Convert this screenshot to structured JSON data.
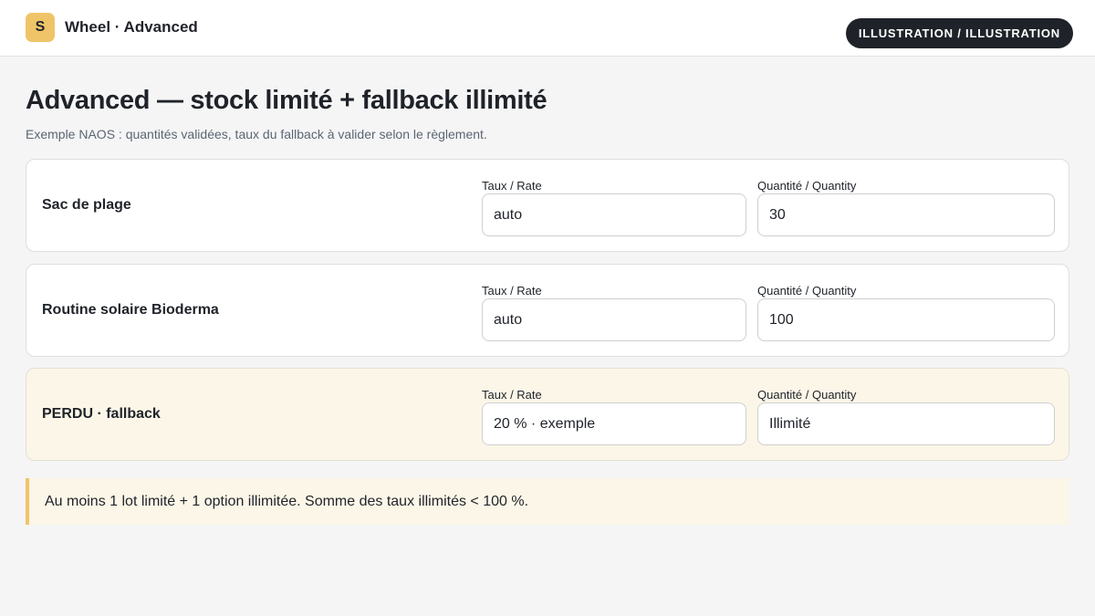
{
  "header": {
    "logo_letter": "S",
    "app_title": "Wheel · Advanced",
    "badge": "ILLUSTRATION / ILLUSTRATION"
  },
  "page": {
    "title": "Advanced — stock limité + fallback illimité",
    "subtitle": "Exemple NAOS : quantités validées, taux du fallback à valider selon le règlement."
  },
  "labels": {
    "rate": "Taux / Rate",
    "quantity": "Quantité / Quantity"
  },
  "prizes": [
    {
      "name": "Sac de plage",
      "rate": "auto",
      "quantity": "30",
      "highlight": false
    },
    {
      "name": "Routine solaire Bioderma",
      "rate": "auto",
      "quantity": "100",
      "highlight": false
    },
    {
      "name": "PERDU · fallback",
      "rate": "20 % · exemple",
      "quantity": "Illimité",
      "highlight": true
    }
  ],
  "note": "Au moins 1 lot limité + 1 option illimitée. Somme des taux illimités < 100 %.",
  "colors": {
    "accent": "#efc469",
    "badge_bg": "#1f2329",
    "highlight_bg": "#fcf6e8",
    "page_bg": "#f5f5f5"
  }
}
